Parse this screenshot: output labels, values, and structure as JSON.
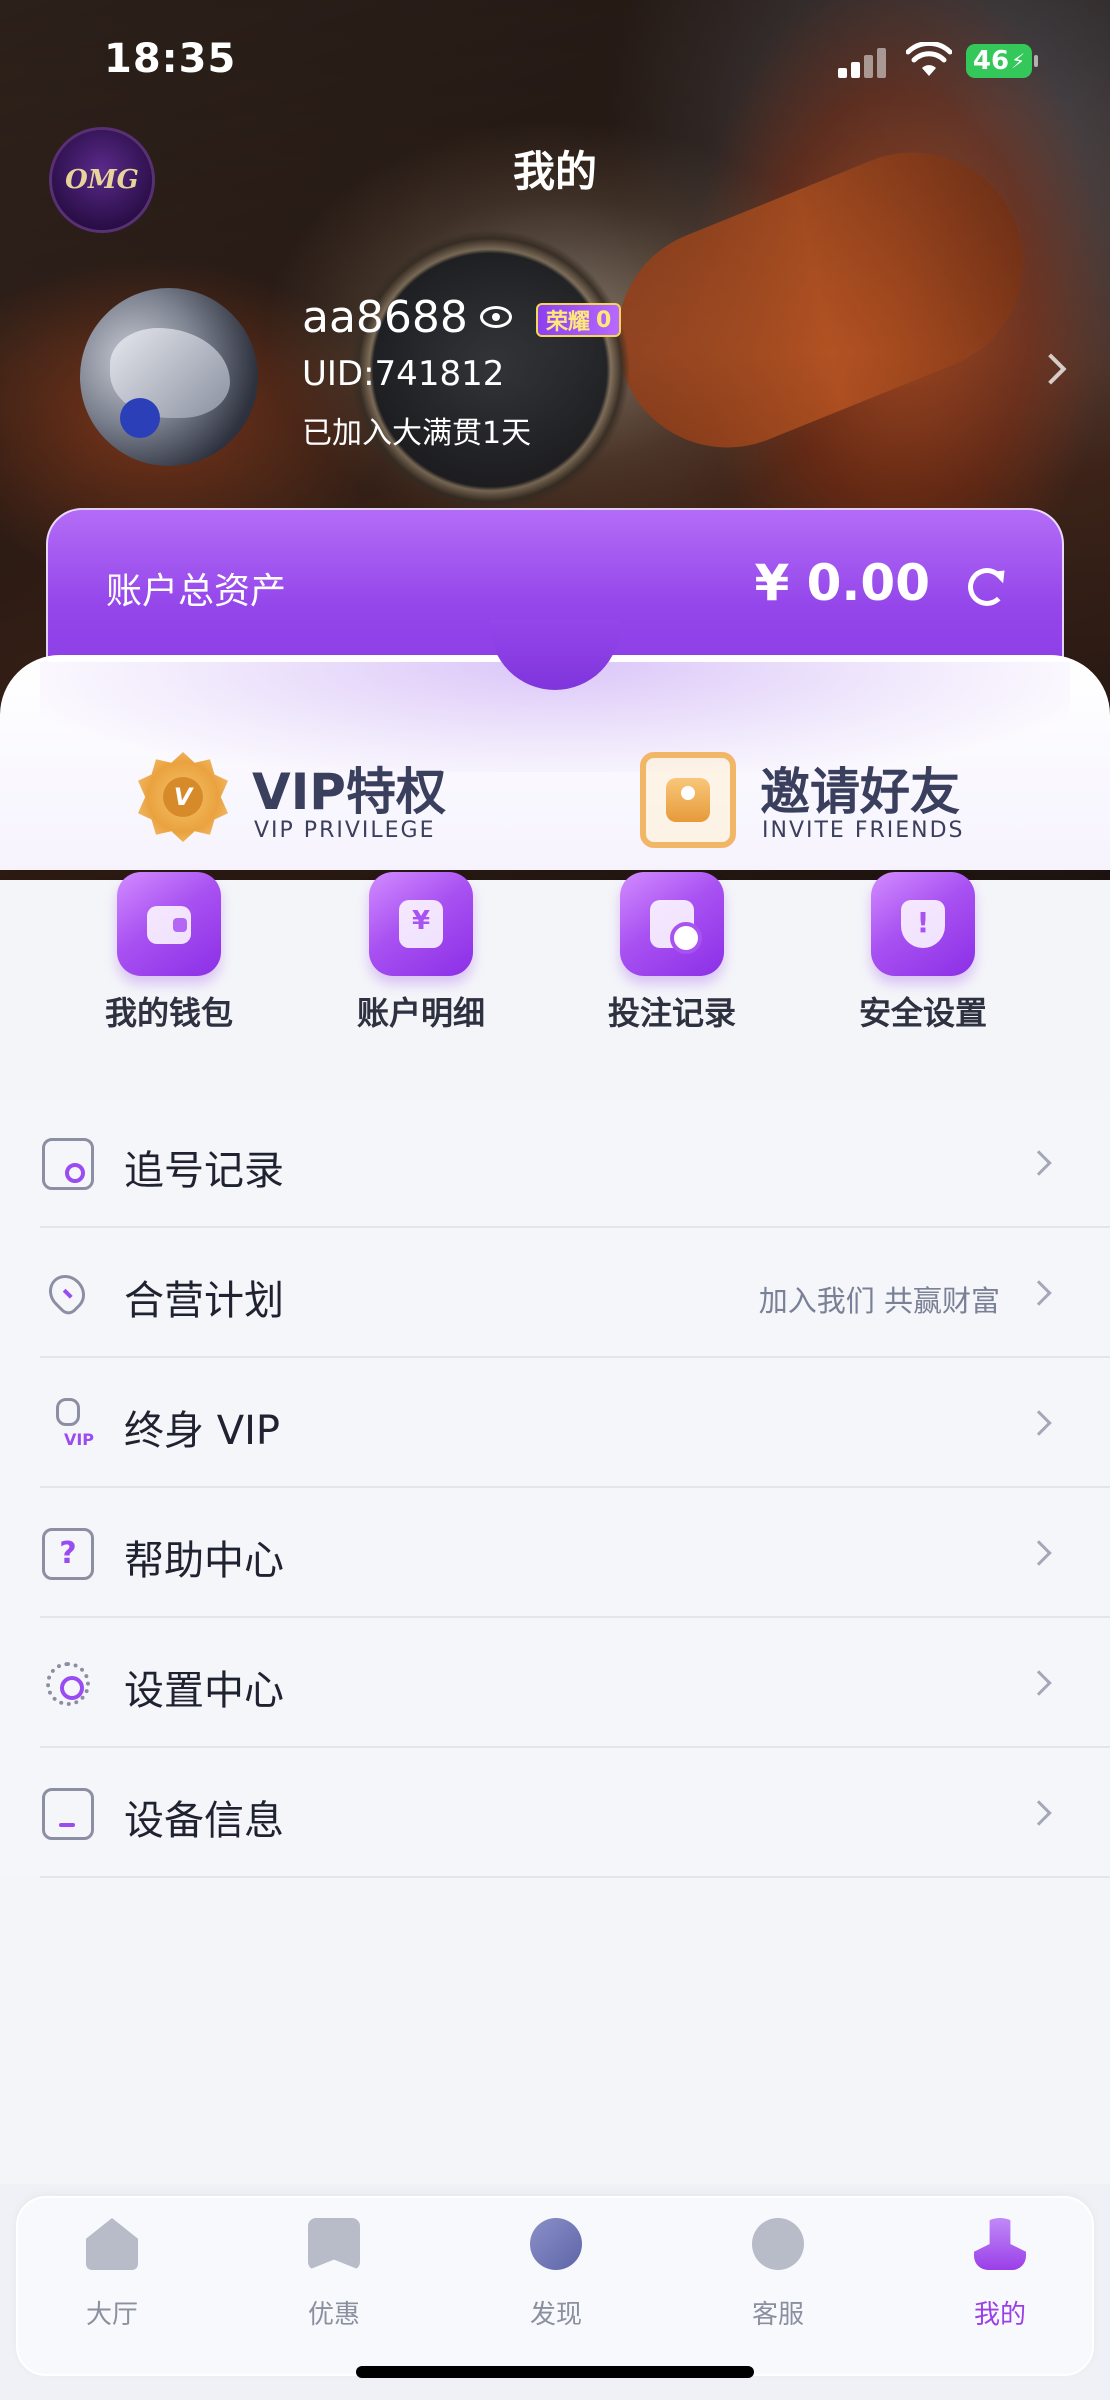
{
  "status_bar": {
    "time": "18:35",
    "battery": "46"
  },
  "header": {
    "logo_text": "OMG",
    "title": "我的"
  },
  "profile": {
    "username": "aa8688",
    "badge_label": "荣耀",
    "badge_level": "0",
    "uid": "UID:741812",
    "joined": "已加入大满贯1天"
  },
  "assets": {
    "label": "账户总资产",
    "value": "¥ 0.00"
  },
  "features": [
    {
      "title": "VIP特权",
      "subtitle": "VIP PRIVILEGE"
    },
    {
      "title": "邀请好友",
      "subtitle": "INVITE FRIENDS"
    }
  ],
  "quick_actions": [
    {
      "label": "我的钱包",
      "icon": "wallet-icon"
    },
    {
      "label": "账户明细",
      "icon": "ledger-icon"
    },
    {
      "label": "投注记录",
      "icon": "bet-record-icon"
    },
    {
      "label": "安全设置",
      "icon": "shield-icon"
    }
  ],
  "menu": [
    {
      "label": "追号记录",
      "note": "",
      "icon": "search-record-icon"
    },
    {
      "label": "合营计划",
      "note": "加入我们 共赢财富",
      "icon": "handshake-heart-icon"
    },
    {
      "label": "终身 VIP",
      "note": "",
      "icon": "vip-user-icon"
    },
    {
      "label": "帮助中心",
      "note": "",
      "icon": "help-icon"
    },
    {
      "label": "设置中心",
      "note": "",
      "icon": "gear-icon"
    },
    {
      "label": "设备信息",
      "note": "",
      "icon": "device-icon"
    }
  ],
  "tabs": [
    {
      "label": "大厅",
      "icon": "home-icon"
    },
    {
      "label": "优惠",
      "icon": "star-bookmark-icon"
    },
    {
      "label": "发现",
      "icon": "compass-icon"
    },
    {
      "label": "客服",
      "icon": "support-face-icon"
    },
    {
      "label": "我的",
      "icon": "user-icon",
      "active": true
    }
  ],
  "colors": {
    "accent": "#9b3fe8",
    "card_top": "#b36cf6",
    "card_bottom": "#8a3de4",
    "gold": "#f2b766"
  }
}
